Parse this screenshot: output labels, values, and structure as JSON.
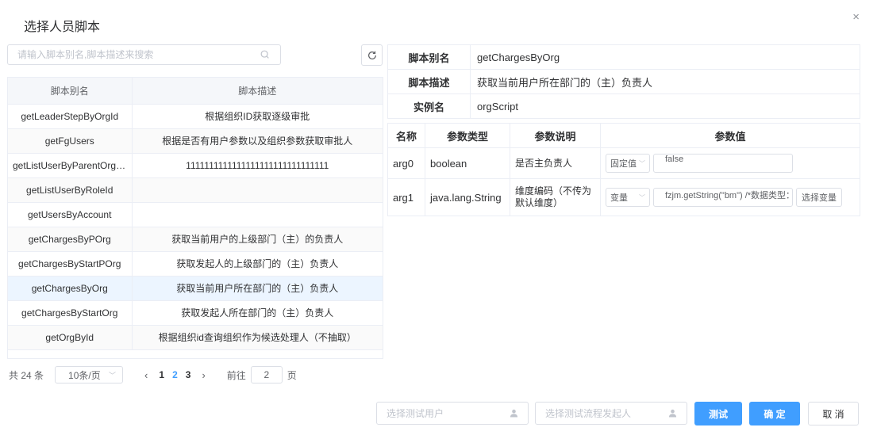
{
  "dialog": {
    "title": "选择人员脚本",
    "close": "×"
  },
  "search": {
    "placeholder": "请输入脚本别名,脚本描述来搜索"
  },
  "script_table": {
    "headers": [
      "脚本别名",
      "脚本描述"
    ],
    "rows": [
      {
        "alias": "getLeaderStepByOrgId",
        "desc": "根据组织ID获取逐级审批"
      },
      {
        "alias": "getFgUsers",
        "desc": "根据是否有用户参数以及组织参数获取审批人"
      },
      {
        "alias": "getListUserByParentOrgR...",
        "desc": "1111111111111111111111111111111"
      },
      {
        "alias": "getListUserByRoleId",
        "desc": ""
      },
      {
        "alias": "getUsersByAccount",
        "desc": ""
      },
      {
        "alias": "getChargesByPOrg",
        "desc": "获取当前用户的上级部门（主）的负责人"
      },
      {
        "alias": "getChargesByStartPOrg",
        "desc": "获取发起人的上级部门的（主）负责人"
      },
      {
        "alias": "getChargesByOrg",
        "desc": "获取当前用户所在部门的（主）负责人"
      },
      {
        "alias": "getChargesByStartOrg",
        "desc": "获取发起人所在部门的（主）负责人"
      },
      {
        "alias": "getOrgById",
        "desc": "根据组织id查询组织作为候选处理人（不抽取）"
      }
    ],
    "selected_index": 7
  },
  "pager": {
    "total": "共 24 条",
    "page_size": "10条/页",
    "prev": "‹",
    "pages": [
      "1",
      "2",
      "3"
    ],
    "active_page": "2",
    "next": "›",
    "goto_label": "前往",
    "goto_value": "2",
    "goto_suffix": "页"
  },
  "info": {
    "alias_label": "脚本别名",
    "alias_value": "getChargesByOrg",
    "desc_label": "脚本描述",
    "desc_value": "获取当前用户所在部门的（主）负责人",
    "instance_label": "实例名",
    "instance_value": "orgScript"
  },
  "params": {
    "headers": [
      "名称",
      "参数类型",
      "参数说明",
      "参数值"
    ],
    "rows": [
      {
        "name": "arg0",
        "type": "boolean",
        "desc": "是否主负责人",
        "mode": "固定值",
        "value": "false",
        "button": ""
      },
      {
        "name": "arg1",
        "type": "java.lang.String",
        "desc": "维度编码（不传为默认维度）",
        "mode": "变量",
        "value": "fzjm.getString(\"bm\") /*数据类型：",
        "button": "选择变量"
      }
    ]
  },
  "footer": {
    "test_user_placeholder": "选择测试用户",
    "test_starter_placeholder": "选择测试流程发起人",
    "test_button": "测试",
    "confirm_button": "确 定",
    "cancel_button": "取 消"
  },
  "colors": {
    "primary": "#409eff",
    "selected_row": "#ecf5ff",
    "border": "#ebeef5"
  }
}
